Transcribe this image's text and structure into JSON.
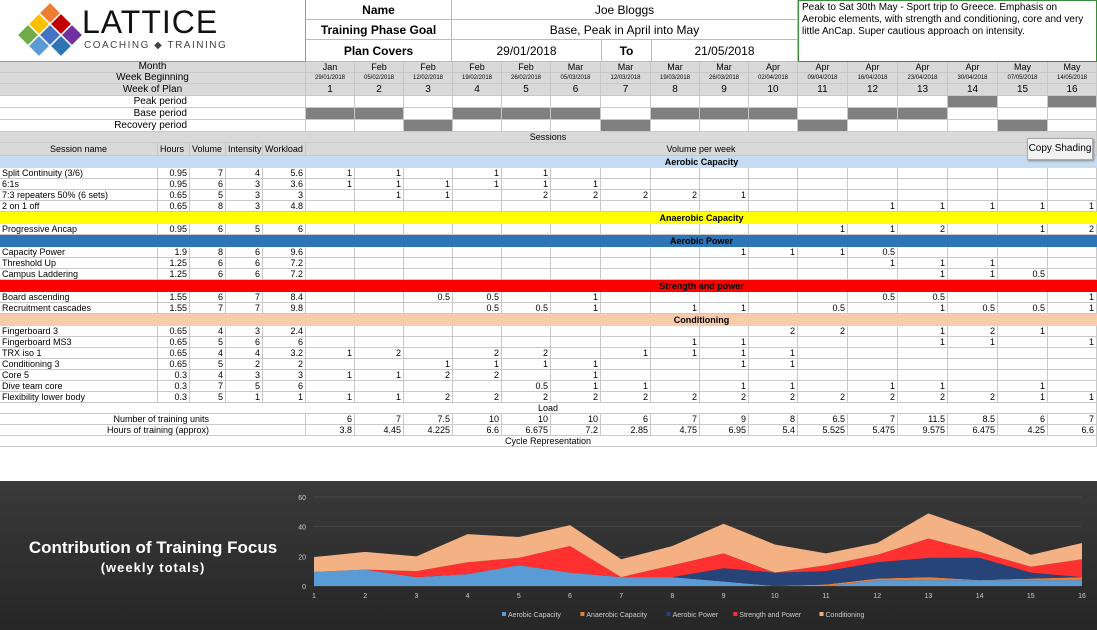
{
  "logo": {
    "word": "LATTICE",
    "sub": "COACHING ◆ TRAINING"
  },
  "header": {
    "name_label": "Name",
    "name_value": "Joe Bloggs",
    "goal_label": "Training Phase Goal",
    "goal_value": "Base, Peak in April into May",
    "plan_label": "Plan Covers",
    "plan_from": "29/01/2018",
    "to_label": "To",
    "plan_to": "21/05/2018",
    "note": "Peak to Sat 30th May - Sport trip to Greece. Emphasis on Aerobic elements, with strength and conditioning, core and very little AnCap. Super cautious approach on intensity."
  },
  "labels": {
    "month": "Month",
    "week_beginning": "Week Beginning",
    "week_of_plan": "Week of Plan",
    "peak": "Peak period",
    "base": "Base period",
    "recovery": "Recovery period",
    "sessions": "Sessions",
    "session_name": "Session name",
    "hours": "Hours",
    "volume": "Volume",
    "intensity": "Intensity",
    "workload": "Workload",
    "volume_per_week": "Volume per week",
    "load": "Load",
    "units": "Number of training units",
    "hours_training": "Hours of training (approx)",
    "cycle": "Cycle Representation",
    "copy_shading": "Copy Shading"
  },
  "months": [
    "Jan",
    "Feb",
    "Feb",
    "Feb",
    "Feb",
    "Mar",
    "Mar",
    "Mar",
    "Mar",
    "Apr",
    "Apr",
    "Apr",
    "Apr",
    "Apr",
    "May",
    "May"
  ],
  "weeks": [
    "29/01/2018",
    "05/02/2018",
    "12/02/2018",
    "19/02/2018",
    "26/02/2018",
    "05/03/2018",
    "12/03/2018",
    "19/03/2018",
    "26/03/2018",
    "02/04/2018",
    "09/04/2018",
    "16/04/2018",
    "23/04/2018",
    "30/04/2018",
    "07/05/2018",
    "14/05/2018"
  ],
  "plan_weeks": [
    "1",
    "2",
    "3",
    "4",
    "5",
    "6",
    "7",
    "8",
    "9",
    "10",
    "11",
    "12",
    "13",
    "14",
    "15",
    "16"
  ],
  "periods": {
    "peak": [
      0,
      0,
      0,
      0,
      0,
      0,
      0,
      0,
      0,
      0,
      0,
      0,
      0,
      1,
      0,
      1
    ],
    "base": [
      1,
      1,
      0,
      1,
      1,
      1,
      0,
      1,
      1,
      1,
      0,
      1,
      1,
      0,
      0,
      0
    ],
    "recovery": [
      0,
      0,
      1,
      0,
      0,
      0,
      1,
      0,
      0,
      0,
      1,
      0,
      0,
      0,
      1,
      0
    ]
  },
  "sections": [
    {
      "title": "Aerobic Capacity",
      "color": "#c5dcf2",
      "rows": [
        {
          "name": "Split Continuity (3/6)",
          "hours": "0.95",
          "volume": "7",
          "intensity": "4",
          "workload": "5.6",
          "weeks": [
            "1",
            "1",
            "",
            "1",
            "1",
            "",
            "",
            "",
            "",
            "",
            "",
            "",
            "",
            "",
            "",
            ""
          ]
        },
        {
          "name": "6:1s",
          "hours": "0.95",
          "volume": "6",
          "intensity": "3",
          "workload": "3.6",
          "weeks": [
            "1",
            "1",
            "1",
            "1",
            "1",
            "1",
            "",
            "",
            "",
            "",
            "",
            "",
            "",
            "",
            "",
            ""
          ]
        },
        {
          "name": "7:3 repeaters 50% (6 sets)",
          "hours": "0.65",
          "volume": "5",
          "intensity": "3",
          "workload": "3",
          "weeks": [
            "",
            "1",
            "1",
            "",
            "2",
            "2",
            "2",
            "2",
            "1",
            "",
            "",
            "",
            "",
            "",
            "",
            ""
          ]
        },
        {
          "name": "2 on 1 off",
          "hours": "0.65",
          "volume": "8",
          "intensity": "3",
          "workload": "4.8",
          "weeks": [
            "",
            "",
            "",
            "",
            "",
            "",
            "",
            "",
            "",
            "",
            "",
            "1",
            "1",
            "1",
            "1",
            "1"
          ]
        }
      ]
    },
    {
      "title": "Anaerobic Capacity",
      "color": "#ffff00",
      "rows": [
        {
          "name": "Progressive Ancap",
          "hours": "0.95",
          "volume": "6",
          "intensity": "5",
          "workload": "6",
          "weeks": [
            "",
            "",
            "",
            "",
            "",
            "",
            "",
            "",
            "",
            "",
            "1",
            "1",
            "2",
            "",
            "1",
            "2"
          ]
        }
      ]
    },
    {
      "title": "Aerobic Power",
      "color": "#2e75b6",
      "rows": [
        {
          "name": "Capacity Power",
          "hours": "1.9",
          "volume": "8",
          "intensity": "6",
          "workload": "9.6",
          "weeks": [
            "",
            "",
            "",
            "",
            "",
            "",
            "",
            "",
            "1",
            "1",
            "1",
            "0.5",
            "",
            "",
            "",
            ""
          ]
        },
        {
          "name": "Threshold Up",
          "hours": "1.25",
          "volume": "6",
          "intensity": "6",
          "workload": "7.2",
          "weeks": [
            "",
            "",
            "",
            "",
            "",
            "",
            "",
            "",
            "",
            "",
            "",
            "1",
            "1",
            "1",
            "",
            ""
          ]
        },
        {
          "name": "Campus Laddering",
          "hours": "1.25",
          "volume": "6",
          "intensity": "6",
          "workload": "7.2",
          "weeks": [
            "",
            "",
            "",
            "",
            "",
            "",
            "",
            "",
            "",
            "",
            "",
            "",
            "1",
            "1",
            "0.5",
            ""
          ]
        }
      ]
    },
    {
      "title": "Strength and power",
      "color": "#ff0000",
      "rows": [
        {
          "name": "Board ascending",
          "hours": "1.55",
          "volume": "6",
          "intensity": "7",
          "workload": "8.4",
          "weeks": [
            "",
            "",
            "0.5",
            "0.5",
            "",
            "1",
            "",
            "",
            "",
            "",
            "",
            "0.5",
            "0.5",
            "",
            "",
            "1"
          ]
        },
        {
          "name": "Recruitment cascades",
          "hours": "1.55",
          "volume": "7",
          "intensity": "7",
          "workload": "9.8",
          "weeks": [
            "",
            "",
            "",
            "0.5",
            "0.5",
            "1",
            "",
            "1",
            "1",
            "",
            "0.5",
            "",
            "1",
            "0.5",
            "0.5",
            "1"
          ]
        }
      ]
    },
    {
      "title": "Conditioning",
      "color": "#f8cbad",
      "rows": [
        {
          "name": "Fingerboard 3",
          "hours": "0.65",
          "volume": "4",
          "intensity": "3",
          "workload": "2.4",
          "weeks": [
            "",
            "",
            "",
            "",
            "",
            "",
            "",
            "",
            "",
            "2",
            "2",
            "",
            "1",
            "2",
            "1",
            ""
          ]
        },
        {
          "name": "Fingerboard MS3",
          "hours": "0.65",
          "volume": "5",
          "intensity": "6",
          "workload": "6",
          "weeks": [
            "",
            "",
            "",
            "",
            "",
            "",
            "",
            "1",
            "1",
            "",
            "",
            "",
            "1",
            "1",
            "",
            "1"
          ]
        },
        {
          "name": "TRX iso 1",
          "hours": "0.65",
          "volume": "4",
          "intensity": "4",
          "workload": "3.2",
          "weeks": [
            "1",
            "2",
            "",
            "2",
            "2",
            "",
            "1",
            "1",
            "1",
            "1",
            "",
            "",
            "",
            "",
            "",
            ""
          ]
        },
        {
          "name": "Conditioning 3",
          "hours": "0.65",
          "volume": "5",
          "intensity": "2",
          "workload": "2",
          "weeks": [
            "",
            "",
            "1",
            "1",
            "1",
            "1",
            "",
            "",
            "1",
            "1",
            "",
            "",
            "",
            "",
            "",
            ""
          ]
        },
        {
          "name": "Core 5",
          "hours": "0.3",
          "volume": "4",
          "intensity": "3",
          "workload": "3",
          "weeks": [
            "1",
            "1",
            "2",
            "2",
            "",
            "1",
            "",
            "",
            "",
            "",
            "",
            "",
            "",
            "",
            "",
            ""
          ]
        },
        {
          "name": "Dive team core",
          "hours": "0.3",
          "volume": "7",
          "intensity": "5",
          "workload": "6",
          "weeks": [
            "",
            "",
            "",
            "",
            "0.5",
            "1",
            "1",
            "",
            "1",
            "1",
            "",
            "1",
            "1",
            "",
            "1",
            ""
          ]
        },
        {
          "name": "Flexibility lower body",
          "hours": "0.3",
          "volume": "5",
          "intensity": "1",
          "workload": "1",
          "weeks": [
            "1",
            "1",
            "2",
            "2",
            "2",
            "2",
            "2",
            "2",
            "2",
            "2",
            "2",
            "2",
            "2",
            "2",
            "1",
            "1"
          ]
        }
      ]
    }
  ],
  "load": {
    "units": [
      "6",
      "7",
      "7.5",
      "10",
      "10",
      "10",
      "6",
      "7",
      "9",
      "8",
      "6.5",
      "7",
      "11.5",
      "8.5",
      "6",
      "7"
    ],
    "hours": [
      "3.8",
      "4.45",
      "4.225",
      "6.6",
      "6.675",
      "7.2",
      "2.85",
      "4.75",
      "6.95",
      "5.4",
      "5.525",
      "5.475",
      "9.575",
      "6.475",
      "4.25",
      "6.6"
    ]
  },
  "chart_data": {
    "type": "area",
    "title": "Contribution of Training Focus",
    "subtitle": "(weekly totals)",
    "x": [
      1,
      2,
      3,
      4,
      5,
      6,
      7,
      8,
      9,
      10,
      11,
      12,
      13,
      14,
      15,
      16
    ],
    "ylim": [
      0,
      60
    ],
    "yticks": [
      0,
      20,
      40,
      60
    ],
    "stacked": true,
    "legend_position": "bottom",
    "series": [
      {
        "name": "Aerobic Capacity",
        "color": "#5b9bd5",
        "values": [
          9.5,
          11,
          6,
          8,
          14,
          9,
          6,
          6,
          3,
          0,
          0,
          4,
          4,
          4,
          4,
          4
        ]
      },
      {
        "name": "Anaerobic Capacity",
        "color": "#ed7d31",
        "values": [
          0,
          0,
          0,
          0,
          0,
          0,
          0,
          0,
          0,
          0,
          1,
          1,
          2,
          0,
          1,
          2
        ]
      },
      {
        "name": "Aerobic Power",
        "color": "#264478",
        "values": [
          0,
          0,
          0,
          0,
          0,
          0,
          0,
          0,
          9,
          9,
          9,
          11,
          13,
          15,
          4,
          0
        ]
      },
      {
        "name": "Strength and Power",
        "color": "#ff3030",
        "values": [
          0,
          0,
          4,
          8,
          5,
          18,
          0,
          8,
          10,
          0,
          4,
          5,
          13,
          4,
          4,
          12
        ]
      },
      {
        "name": "Conditioning",
        "color": "#f4b183",
        "values": [
          10,
          12,
          10,
          19,
          14,
          14,
          12,
          13,
          20,
          19,
          8,
          8,
          17,
          14,
          8,
          11
        ]
      }
    ]
  }
}
